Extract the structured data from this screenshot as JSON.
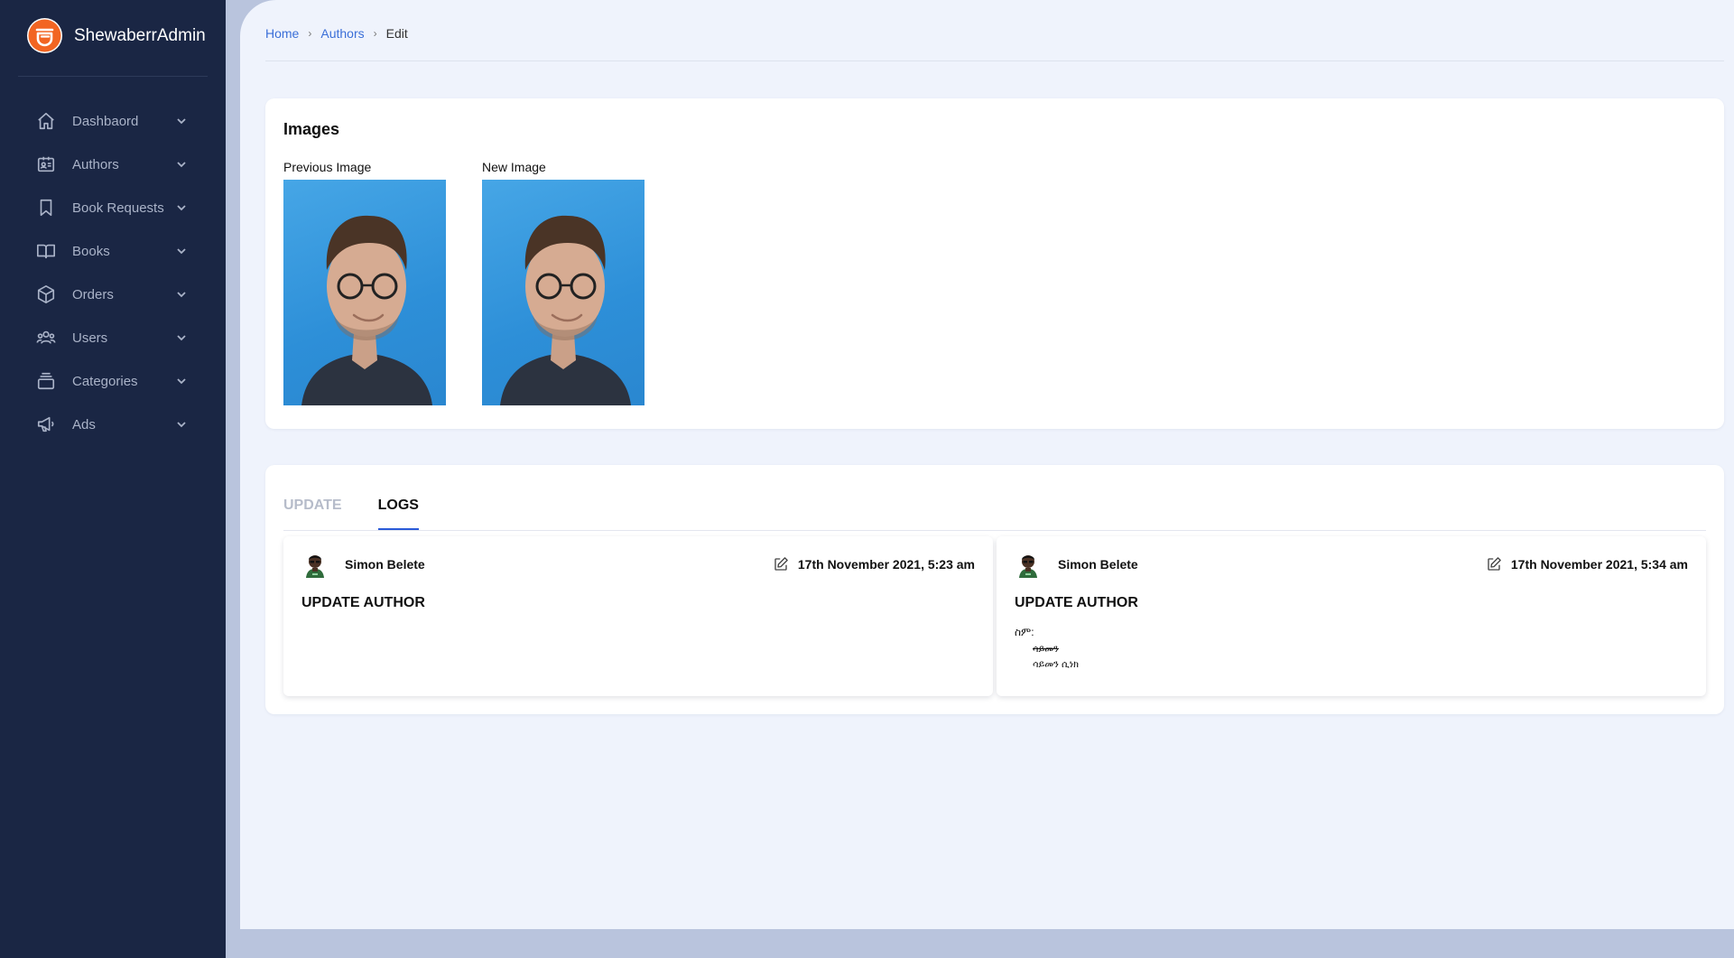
{
  "app": {
    "brand": "ShewaberrAdmin",
    "accent_color": "#3b6fd8",
    "sidebar_color": "#1a2644",
    "logo_color": "#f26522"
  },
  "sidebar": {
    "items": [
      {
        "label": "Dashbaord",
        "icon": "home-icon"
      },
      {
        "label": "Authors",
        "icon": "id-card-icon"
      },
      {
        "label": "Book Requests",
        "icon": "bookmark-icon"
      },
      {
        "label": "Books",
        "icon": "open-book-icon"
      },
      {
        "label": "Orders",
        "icon": "box-icon"
      },
      {
        "label": "Users",
        "icon": "users-icon"
      },
      {
        "label": "Categories",
        "icon": "archive-icon"
      },
      {
        "label": "Ads",
        "icon": "megaphone-icon"
      }
    ]
  },
  "breadcrumb": {
    "home": "Home",
    "authors": "Authors",
    "current": "Edit"
  },
  "images": {
    "title": "Images",
    "previous_label": "Previous Image",
    "new_label": "New Image"
  },
  "tabs": {
    "update": "UPDATE",
    "logs": "LOGS",
    "active": "LOGS"
  },
  "logs": [
    {
      "user": "Simon Belete",
      "time": "17th November 2021, 5:23 am",
      "action": "UPDATE AUTHOR",
      "field": "",
      "old_value": "",
      "new_value": ""
    },
    {
      "user": "Simon Belete",
      "time": "17th November 2021, 5:34 am",
      "action": "UPDATE AUTHOR",
      "field": "ስም:",
      "old_value": "ሳይመን",
      "new_value": "ሳይመን ሲነክ"
    }
  ]
}
